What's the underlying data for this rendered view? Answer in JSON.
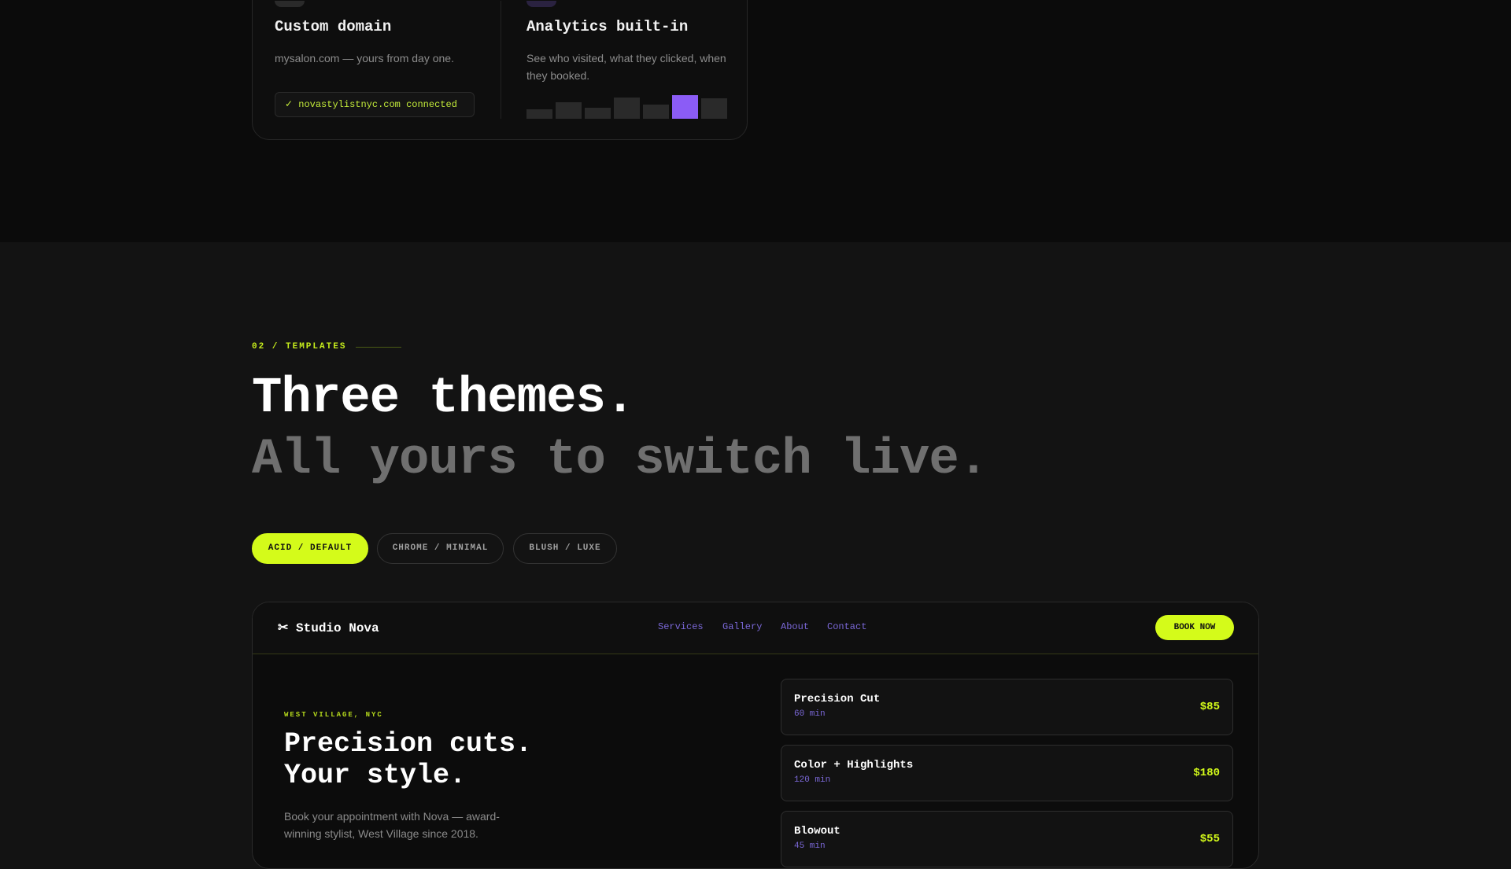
{
  "features": [
    {
      "title": "Custom domain",
      "desc": "mysalon.com — yours from day one.",
      "badge": "✓ novastylistnyc.com connected"
    },
    {
      "title": "Analytics built-in",
      "desc": "See who visited, what they clicked, when they booked.",
      "bars": [
        0.4,
        0.7,
        0.45,
        0.9,
        0.6,
        1.0,
        0.85
      ],
      "highlighted_bar_index": 5
    }
  ],
  "templates": {
    "eyebrow": "02 / TEMPLATES",
    "headline": "Three themes.",
    "subheadline": "All yours to switch live.",
    "tabs": [
      {
        "label": "ACID / DEFAULT",
        "active": true
      },
      {
        "label": "CHROME / MINIMAL",
        "active": false
      },
      {
        "label": "BLUSH / LUXE",
        "active": false
      }
    ]
  },
  "preview": {
    "brand": "✂ Studio Nova",
    "nav": [
      "Services",
      "Gallery",
      "About",
      "Contact"
    ],
    "cta": "BOOK NOW",
    "location": "WEST VILLAGE, NYC",
    "headline_line1": "Precision cuts.",
    "headline_line2": "Your style.",
    "description": "Book your appointment with Nova — award-winning stylist, West Village since 2018.",
    "services": [
      {
        "name": "Precision Cut",
        "duration": "60 min",
        "price": "$85"
      },
      {
        "name": "Color + Highlights",
        "duration": "120 min",
        "price": "$180"
      },
      {
        "name": "Blowout",
        "duration": "45 min",
        "price": "$55"
      }
    ]
  },
  "colors": {
    "accent": "#d4fb1a",
    "violet": "#8b5cf6",
    "background": "#131313"
  }
}
